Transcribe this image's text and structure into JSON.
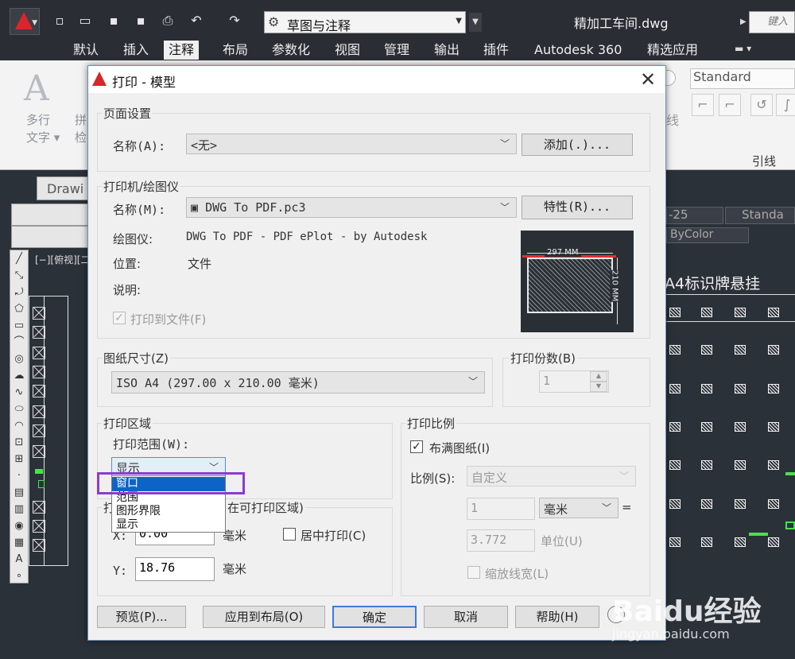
{
  "titlebar": {
    "workspace": "草图与注释",
    "file_title": "精加工车间.dwg",
    "search_placeholder": "键入"
  },
  "ribbon": {
    "tabs": [
      "默认",
      "插入",
      "注释",
      "布局",
      "参数化",
      "视图",
      "管理",
      "输出",
      "插件",
      "Autodesk 360",
      "精选应用"
    ],
    "active_tab": "注释",
    "mtext_label": "多行\n文字",
    "partial_label": "拼\n检",
    "text_style": "Standard",
    "leader_side": "线",
    "leader_label": "引线"
  },
  "drawing": {
    "doc_tab": "Drawi",
    "view_label": "[−][俯视][二维",
    "dimstyle": "-25",
    "style_right": "Standa",
    "color": "ByColor",
    "sign_label": "A4标识牌悬挂"
  },
  "dialog": {
    "title": "打印 - 模型",
    "page_setup": {
      "group": "页面设置",
      "name_label": "名称(A):",
      "name_value": "<无>",
      "add_button": "添加(.)..."
    },
    "printer": {
      "group": "打印机/绘图仪",
      "name_label": "名称(M):",
      "name_value": "DWG To PDF.pc3",
      "properties_button": "特性(R)...",
      "plotter_label": "绘图仪:",
      "plotter_value": "DWG To PDF - PDF ePlot - by Autodesk",
      "location_label": "位置:",
      "location_value": "文件",
      "description_label": "说明:",
      "print_to_file": "打印到文件(F)",
      "preview_width": "297 MM",
      "preview_height": "210 MM"
    },
    "paper": {
      "group": "图纸尺寸(Z)",
      "value": "ISO A4 (297.00 x 210.00 毫米)"
    },
    "copies": {
      "group": "打印份数(B)",
      "value": "1"
    },
    "area": {
      "group": "打印区域",
      "range_label": "打印范围(W):",
      "range_value": "显示",
      "options": [
        "窗口",
        "范围",
        "图形界限",
        "显示"
      ],
      "selected_option": "窗口"
    },
    "offset": {
      "group_prefix": "打",
      "group_suffix": "在可打印区域)",
      "x_label": "X:",
      "x_value": "0.00",
      "y_label": "Y:",
      "y_value": "18.76",
      "unit": "毫米",
      "center_label": "居中打印(C)"
    },
    "scale": {
      "group": "打印比例",
      "fit_label": "布满图纸(I)",
      "fit_checked": true,
      "scale_label": "比例(S):",
      "scale_value": "自定义",
      "num_value": "1",
      "unit_value": "毫米",
      "equals": "=",
      "den_value": "3.772",
      "unit_label": "单位(U)",
      "lineweight_label": "缩放线宽(L)"
    },
    "buttons": {
      "preview": "预览(P)...",
      "apply_layout": "应用到布局(O)",
      "ok": "确定",
      "cancel": "取消",
      "help": "帮助(H)"
    }
  },
  "watermark": {
    "brand": "Baidu经验",
    "url": "jingyan.baidu.com"
  }
}
